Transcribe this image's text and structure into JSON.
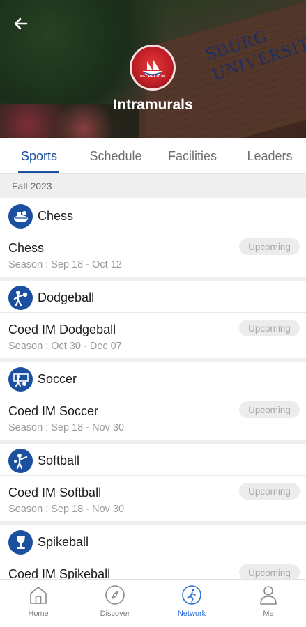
{
  "header": {
    "title": "Intramurals",
    "logo_text": "RECREATION",
    "sign_text": "SBURG UNIVERSITY",
    "back_icon": "arrow-left-icon"
  },
  "tabs": [
    {
      "label": "Sports",
      "active": true
    },
    {
      "label": "Schedule",
      "active": false
    },
    {
      "label": "Facilities",
      "active": false
    },
    {
      "label": "Leaders",
      "active": false
    }
  ],
  "section": {
    "label": "Fall 2023"
  },
  "sports": [
    {
      "name": "Chess",
      "icon": "chess-icon",
      "league": "Chess",
      "season": "Season : Sep 18 - Oct 12",
      "status": "Upcoming"
    },
    {
      "name": "Dodgeball",
      "icon": "dodgeball-icon",
      "league": "Coed IM Dodgeball",
      "season": "Season : Oct 30 - Dec 07",
      "status": "Upcoming"
    },
    {
      "name": "Soccer",
      "icon": "soccer-icon",
      "league": "Coed IM Soccer",
      "season": "Season : Sep 18 - Nov 30",
      "status": "Upcoming"
    },
    {
      "name": "Softball",
      "icon": "softball-icon",
      "league": "Coed IM Softball",
      "season": "Season : Sep 18 - Nov 30",
      "status": "Upcoming"
    },
    {
      "name": "Spikeball",
      "icon": "spikeball-icon",
      "league": "Coed IM Spikeball",
      "season": "",
      "status": "Upcoming"
    }
  ],
  "bottom_nav": [
    {
      "label": "Home",
      "icon": "home-icon",
      "active": false
    },
    {
      "label": "Discover",
      "icon": "compass-icon",
      "active": false
    },
    {
      "label": "Network",
      "icon": "network-icon",
      "active": true
    },
    {
      "label": "Me",
      "icon": "user-icon",
      "active": false
    }
  ],
  "colors": {
    "accent": "#1b4fa0",
    "nav_active": "#2b6fd4",
    "badge_bg": "#ececec",
    "badge_text": "#a9a9a9"
  }
}
